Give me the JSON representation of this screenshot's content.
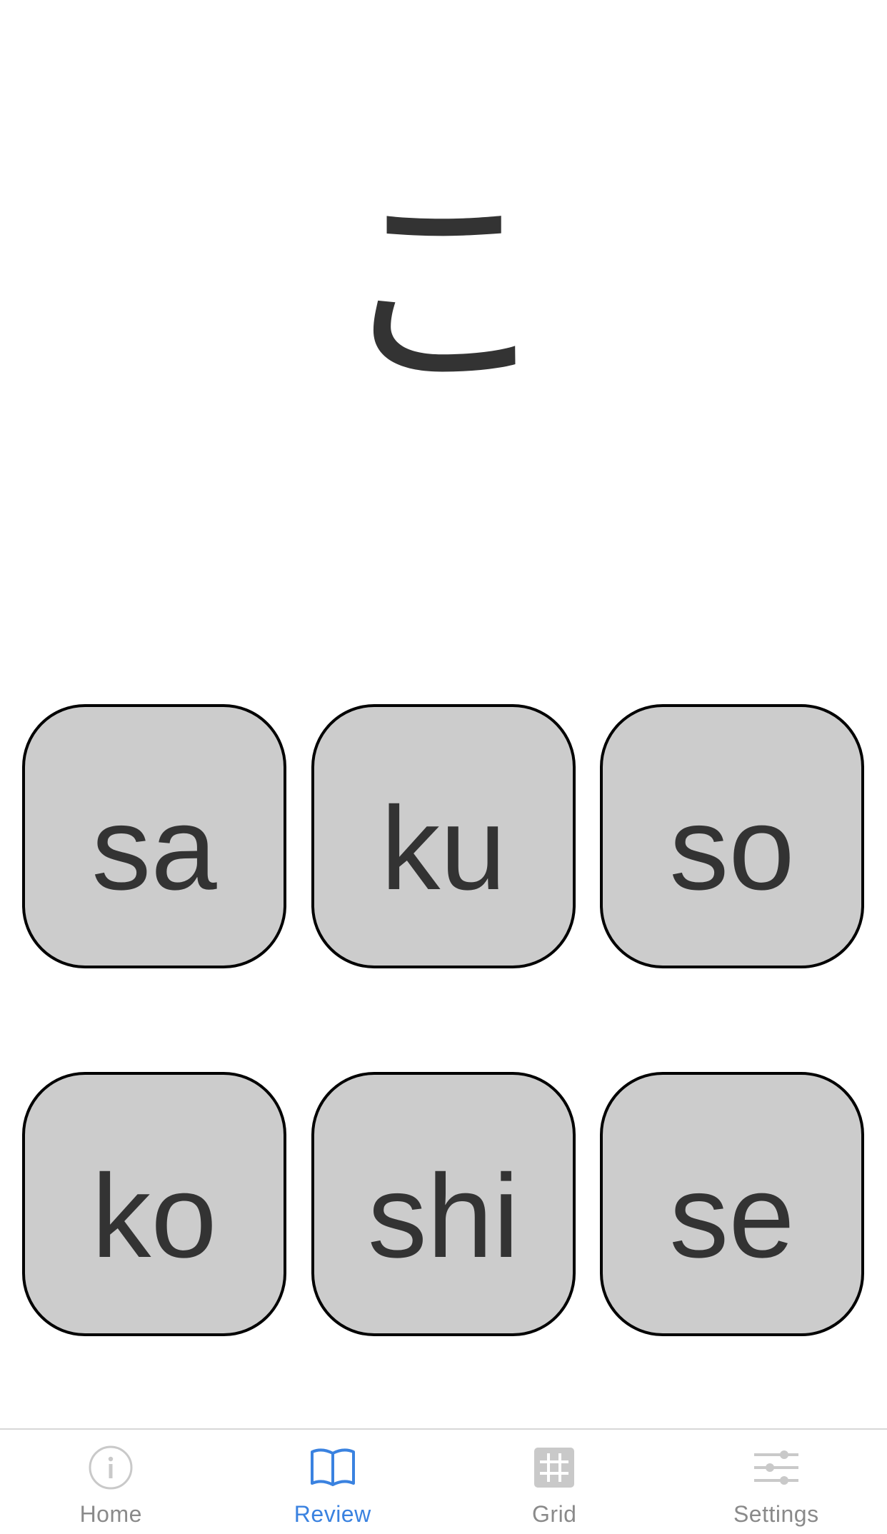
{
  "prompt": {
    "character": "こ"
  },
  "answers": [
    {
      "label": "sa"
    },
    {
      "label": "ku"
    },
    {
      "label": "so"
    },
    {
      "label": "ko"
    },
    {
      "label": "shi"
    },
    {
      "label": "se"
    }
  ],
  "tabbar": {
    "active": "Review",
    "tabs": [
      {
        "label": "Home",
        "icon": "info-circle-icon"
      },
      {
        "label": "Review",
        "icon": "open-book-icon"
      },
      {
        "label": "Grid",
        "icon": "grid-hash-icon"
      },
      {
        "label": "Settings",
        "icon": "sliders-icon"
      }
    ]
  },
  "colors": {
    "accent": "#3a82e0",
    "inactive": "#8a8a8a",
    "button_fill": "#cccccc",
    "text": "#333333"
  }
}
